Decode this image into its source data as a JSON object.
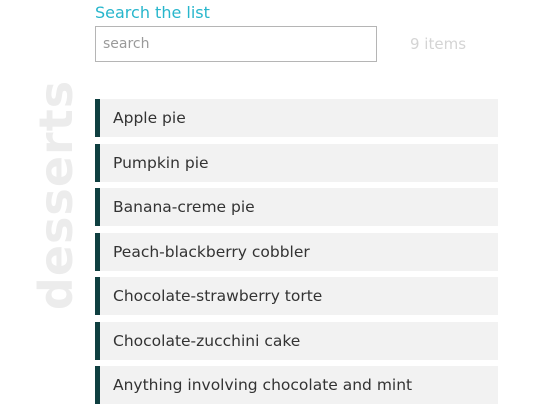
{
  "search": {
    "label": "Search the list",
    "placeholder": "search",
    "value": "",
    "count_text": "9 items"
  },
  "category_label": "desserts",
  "colors": {
    "accent": "#27b6cc",
    "item_border": "#0f3f40",
    "item_background": "#f2f2f2"
  },
  "items": [
    "Apple pie",
    "Pumpkin pie",
    "Banana-creme pie",
    "Peach-blackberry cobbler",
    "Chocolate-strawberry torte",
    "Chocolate-zucchini cake",
    "Anything involving chocolate and mint"
  ]
}
